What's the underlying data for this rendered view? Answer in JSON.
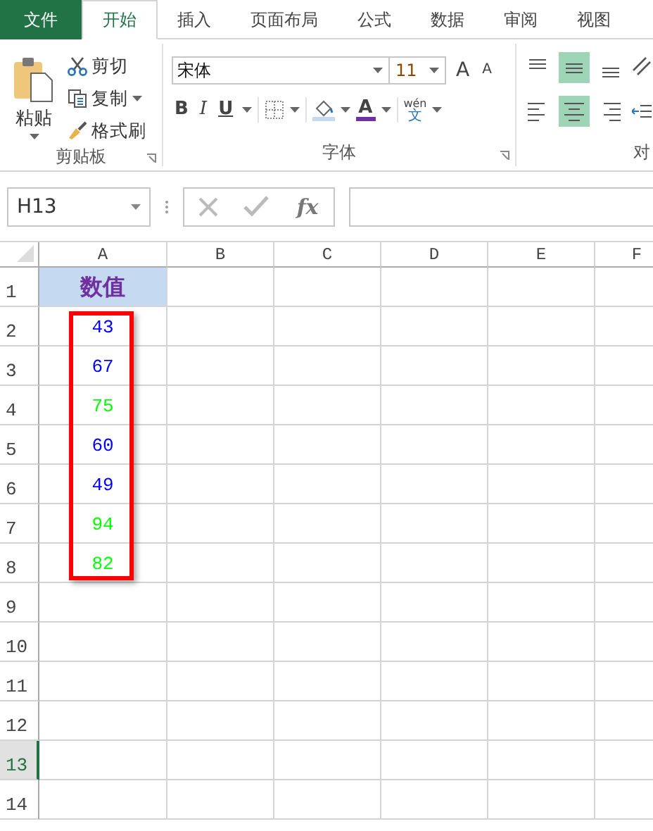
{
  "tabs": [
    {
      "label": "文件",
      "kind": "file",
      "selected": false
    },
    {
      "label": "开始",
      "kind": "tab",
      "selected": true
    },
    {
      "label": "插入",
      "kind": "tab",
      "selected": false
    },
    {
      "label": "页面布局",
      "kind": "tab",
      "selected": false
    },
    {
      "label": "公式",
      "kind": "tab",
      "selected": false
    },
    {
      "label": "数据",
      "kind": "tab",
      "selected": false
    },
    {
      "label": "审阅",
      "kind": "tab",
      "selected": false
    },
    {
      "label": "视图",
      "kind": "tab",
      "selected": false
    }
  ],
  "clipboard": {
    "paste": "粘贴",
    "cut": "剪切",
    "copy": "复制",
    "format_painter": "格式刷",
    "group_label": "剪贴板"
  },
  "font": {
    "name": "宋体",
    "size": "11",
    "grow": "A",
    "shrink": "A",
    "bold": "B",
    "italic": "I",
    "underline": "U",
    "font_color": "A",
    "phonetic_top": "wén",
    "phonetic_bottom": "文",
    "group_label": "字体"
  },
  "alignment": {
    "group_label": "对",
    "items": [
      {
        "kind": "top",
        "selected": false
      },
      {
        "kind": "middle",
        "selected": true
      },
      {
        "kind": "bottom",
        "selected": false
      },
      {
        "kind": "left",
        "selected": false
      },
      {
        "kind": "center",
        "selected": true
      },
      {
        "kind": "right",
        "selected": false
      }
    ]
  },
  "formula_bar": {
    "name_box": "H13",
    "fx": "fx"
  },
  "columns": [
    "A",
    "B",
    "C",
    "D",
    "E",
    "F"
  ],
  "rows": [
    {
      "label": "1",
      "selected": false
    },
    {
      "label": "2",
      "selected": false
    },
    {
      "label": "3",
      "selected": false
    },
    {
      "label": "4",
      "selected": false
    },
    {
      "label": "5",
      "selected": false
    },
    {
      "label": "6",
      "selected": false
    },
    {
      "label": "7",
      "selected": false
    },
    {
      "label": "8",
      "selected": false
    },
    {
      "label": "9",
      "selected": false
    },
    {
      "label": "10",
      "selected": false
    },
    {
      "label": "11",
      "selected": false
    },
    {
      "label": "12",
      "selected": false
    },
    {
      "label": "13",
      "selected": true
    },
    {
      "label": "14",
      "selected": false
    }
  ],
  "header_cell": {
    "text": "数值"
  },
  "values": [
    {
      "text": "43",
      "color": "#0000ff"
    },
    {
      "text": "67",
      "color": "#0000ff"
    },
    {
      "text": "75",
      "color": "#00ff00"
    },
    {
      "text": "60",
      "color": "#0000ff"
    },
    {
      "text": "49",
      "color": "#0000ff"
    },
    {
      "text": "94",
      "color": "#00ff00"
    },
    {
      "text": "82",
      "color": "#00ff00"
    }
  ]
}
